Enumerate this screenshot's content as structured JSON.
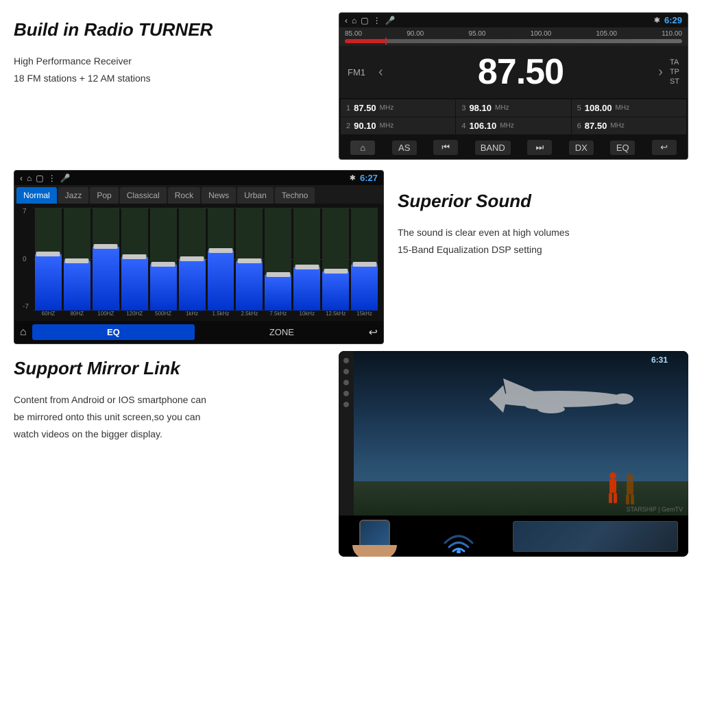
{
  "radio": {
    "title": "Build in Radio TURNER",
    "desc_line1": "High Performance Receiver",
    "desc_line2": "18 FM stations + 12 AM stations",
    "status_bar": {
      "time": "6:29",
      "bluetooth": "✱"
    },
    "freq_scales": [
      "85.00",
      "90.00",
      "95.00",
      "100.00",
      "105.00",
      "110.00"
    ],
    "band": "FM1",
    "frequency": "87.50",
    "info_tags": [
      "TA",
      "TP",
      "ST"
    ],
    "presets": [
      {
        "num": "1",
        "freq": "87.50",
        "unit": "MHz"
      },
      {
        "num": "3",
        "freq": "98.10",
        "unit": "MHz"
      },
      {
        "num": "5",
        "freq": "108.00",
        "unit": "MHz"
      },
      {
        "num": "2",
        "freq": "90.10",
        "unit": "MHz"
      },
      {
        "num": "4",
        "freq": "106.10",
        "unit": "MHz"
      },
      {
        "num": "6",
        "freq": "87.50",
        "unit": "MHz"
      }
    ],
    "controls": [
      "AS",
      "⏮",
      "BAND",
      "⏭",
      "DX",
      "EQ",
      "↩"
    ]
  },
  "equalizer": {
    "title": "Superior Sound",
    "desc_line1": "The sound is clear even at high volumes",
    "desc_line2": "15-Band Equalization DSP setting",
    "status_bar": {
      "time": "6:27",
      "bluetooth": "✱"
    },
    "modes": [
      "Normal",
      "Jazz",
      "Pop",
      "Classical",
      "Rock",
      "News",
      "Urban",
      "Techno"
    ],
    "active_mode": "Normal",
    "level_labels": [
      "7",
      "0",
      "-7"
    ],
    "bands": [
      {
        "freq": "60HZ",
        "fill_pct": 55,
        "handle_pct": 45
      },
      {
        "freq": "80HZ",
        "fill_pct": 48,
        "handle_pct": 52
      },
      {
        "freq": "100HZ",
        "fill_pct": 60,
        "handle_pct": 40
      },
      {
        "freq": "120HZ",
        "fill_pct": 52,
        "handle_pct": 48
      },
      {
        "freq": "500HZ",
        "fill_pct": 45,
        "handle_pct": 55
      },
      {
        "freq": "1kHz",
        "fill_pct": 50,
        "handle_pct": 50
      },
      {
        "freq": "1.5kHz",
        "fill_pct": 58,
        "handle_pct": 42
      },
      {
        "freq": "2.5kHz",
        "fill_pct": 48,
        "handle_pct": 52
      },
      {
        "freq": "7.5kHz",
        "fill_pct": 35,
        "handle_pct": 65
      },
      {
        "freq": "10kHz",
        "fill_pct": 42,
        "handle_pct": 58
      },
      {
        "freq": "12.5kHz",
        "fill_pct": 38,
        "handle_pct": 62
      },
      {
        "freq": "15kHz",
        "fill_pct": 45,
        "handle_pct": 55
      }
    ],
    "bottom_controls": {
      "home": "⌂",
      "eq_label": "EQ",
      "zone_label": "ZONE",
      "back": "↩"
    }
  },
  "mirror": {
    "title": "Support Mirror Link",
    "desc_line1": "Content from Android or IOS smartphone can",
    "desc_line2": "be mirrored onto this unit screen,so you can",
    "desc_line3": "watch videos on the  bigger display.",
    "screen_time": "6:31",
    "watermark": "STARSHIP | GemTV"
  },
  "icons": {
    "back_arrow": "‹",
    "home": "⌂",
    "square": "▢",
    "dots": "⋮",
    "mic": "🎤",
    "bluetooth": "✱",
    "left_arrow": "‹",
    "right_arrow": "›",
    "prev": "⏮",
    "next": "⏭"
  }
}
